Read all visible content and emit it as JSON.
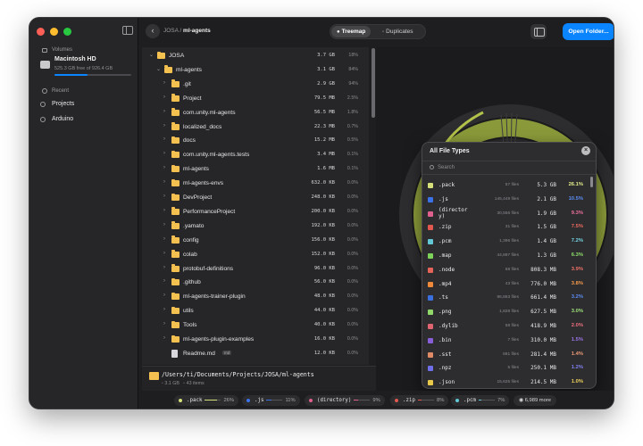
{
  "sidebar": {
    "volumes_label": "Volumes",
    "disk_name": "Macintosh HD",
    "disk_free": "525.3 GB free of 926.4 GB",
    "disk_used_fraction": 0.43,
    "recent_label": "Recent",
    "recent_items": [
      "Projects",
      "Arduino"
    ]
  },
  "toolbar": {
    "breadcrumb_parent": "JOSA",
    "breadcrumb_sep": " / ",
    "breadcrumb_current": "ml-agents",
    "tab_treemap": "Treemap",
    "tab_duplicates": "Duplicates",
    "open_folder": "Open Folder..."
  },
  "tree": [
    {
      "name": "JOSA",
      "size": "3.7 GB",
      "pct": "18%",
      "depth": 0,
      "expanded": true,
      "kind": "folder"
    },
    {
      "name": "ml-agents",
      "size": "3.1 GB",
      "pct": "84%",
      "depth": 1,
      "expanded": true,
      "kind": "folder"
    },
    {
      "name": ".git",
      "size": "2.9 GB",
      "pct": "94%",
      "depth": 2,
      "kind": "folder"
    },
    {
      "name": "Project",
      "size": "79.5 MB",
      "pct": "2.5%",
      "depth": 2,
      "kind": "folder"
    },
    {
      "name": "com.unity.ml-agents",
      "size": "56.5 MB",
      "pct": "1.8%",
      "depth": 2,
      "kind": "folder"
    },
    {
      "name": "localized_docs",
      "size": "22.3 MB",
      "pct": "0.7%",
      "depth": 2,
      "kind": "folder"
    },
    {
      "name": "docs",
      "size": "15.2 MB",
      "pct": "0.5%",
      "depth": 2,
      "kind": "folder"
    },
    {
      "name": "com.unity.ml-agents.tests",
      "size": "3.4 MB",
      "pct": "0.1%",
      "depth": 2,
      "kind": "folder"
    },
    {
      "name": "ml-agents",
      "size": "1.6 MB",
      "pct": "0.1%",
      "depth": 2,
      "kind": "folder"
    },
    {
      "name": "ml-agents-envs",
      "size": "632.0 KB",
      "pct": "0.0%",
      "depth": 2,
      "kind": "folder"
    },
    {
      "name": "DevProject",
      "size": "248.0 KB",
      "pct": "0.0%",
      "depth": 2,
      "kind": "folder"
    },
    {
      "name": "PerformanceProject",
      "size": "200.0 KB",
      "pct": "0.0%",
      "depth": 2,
      "kind": "folder"
    },
    {
      "name": ".yamato",
      "size": "192.0 KB",
      "pct": "0.0%",
      "depth": 2,
      "kind": "folder"
    },
    {
      "name": "config",
      "size": "156.0 KB",
      "pct": "0.0%",
      "depth": 2,
      "kind": "folder"
    },
    {
      "name": "colab",
      "size": "152.0 KB",
      "pct": "0.0%",
      "depth": 2,
      "kind": "folder"
    },
    {
      "name": "protobuf-definitions",
      "size": "96.0 KB",
      "pct": "0.0%",
      "depth": 2,
      "kind": "folder"
    },
    {
      "name": ".github",
      "size": "56.0 KB",
      "pct": "0.0%",
      "depth": 2,
      "kind": "folder"
    },
    {
      "name": "ml-agents-trainer-plugin",
      "size": "48.0 KB",
      "pct": "0.0%",
      "depth": 2,
      "kind": "folder"
    },
    {
      "name": "utils",
      "size": "44.0 KB",
      "pct": "0.0%",
      "depth": 2,
      "kind": "folder"
    },
    {
      "name": "Tools",
      "size": "40.0 KB",
      "pct": "0.0%",
      "depth": 2,
      "kind": "folder"
    },
    {
      "name": "ml-agents-plugin-examples",
      "size": "16.0 KB",
      "pct": "0.0%",
      "depth": 2,
      "kind": "folder"
    },
    {
      "name": "Readme.md",
      "size": "12.0 KB",
      "pct": "0.0%",
      "depth": 2,
      "kind": "file",
      "badge": "md"
    }
  ],
  "pathbar": {
    "path": "/Users/ti/Documents/Projects/JOSA/ml-agents",
    "size": "3.1 GB",
    "items": "43 items"
  },
  "popup": {
    "title": "All File Types",
    "search_placeholder": "Search",
    "rows": [
      {
        "ext": ".pack",
        "count": "57 files",
        "size": "5.3 GB",
        "pct": "26.1%",
        "color": "#d5e07a",
        "pct_color": "#e4ec8a"
      },
      {
        "ext": ".js",
        "count": "145,449 files",
        "size": "2.1 GB",
        "pct": "10.5%",
        "color": "#3c72e8",
        "pct_color": "#5b8cf5"
      },
      {
        "ext": "(director\ny)",
        "count": "30,556 files",
        "size": "1.9 GB",
        "pct": "9.3%",
        "color": "#e0608e",
        "pct_color": "#ef6f9c"
      },
      {
        "ext": ".zip",
        "count": "31 files",
        "size": "1.5 GB",
        "pct": "7.5%",
        "color": "#e0584e",
        "pct_color": "#ef6a5e"
      },
      {
        "ext": ".pcm",
        "count": "1,396 files",
        "size": "1.4 GB",
        "pct": "7.2%",
        "color": "#62c8d6",
        "pct_color": "#74d7e4"
      },
      {
        "ext": ".map",
        "count": "44,897 files",
        "size": "1.3 GB",
        "pct": "6.3%",
        "color": "#7dd35a",
        "pct_color": "#8fe06a"
      },
      {
        "ext": ".node",
        "count": "68 files",
        "size": "808.3 MB",
        "pct": "3.9%",
        "color": "#e5645a",
        "pct_color": "#ef7166"
      },
      {
        "ext": ".mp4",
        "count": "43 files",
        "size": "776.0 MB",
        "pct": "3.8%",
        "color": "#f08a3a",
        "pct_color": "#f59a4a"
      },
      {
        "ext": ".ts",
        "count": "86,863 files",
        "size": "661.4 MB",
        "pct": "3.2%",
        "color": "#3a6fe0",
        "pct_color": "#5b8cf5"
      },
      {
        "ext": ".png",
        "count": "1,828 files",
        "size": "627.5 MB",
        "pct": "3.0%",
        "color": "#90d86a",
        "pct_color": "#9fe47a"
      },
      {
        "ext": ".dylib",
        "count": "58 files",
        "size": "418.9 MB",
        "pct": "2.0%",
        "color": "#e06470",
        "pct_color": "#ef707c"
      },
      {
        "ext": ".bin",
        "count": "7 files",
        "size": "310.0 MB",
        "pct": "1.5%",
        "color": "#8a5ed8",
        "pct_color": "#9b74e6"
      },
      {
        "ext": ".sst",
        "count": "681 files",
        "size": "281.4 MB",
        "pct": "1.4%",
        "color": "#e08a66",
        "pct_color": "#ef9a76"
      },
      {
        "ext": ".npz",
        "count": "5 files",
        "size": "250.1 MB",
        "pct": "1.2%",
        "color": "#6e6ee8",
        "pct_color": "#8080f2"
      },
      {
        "ext": ".json",
        "count": "15,625 files",
        "size": "214.5 MB",
        "pct": "1.0%",
        "color": "#e8c94a",
        "pct_color": "#f0d45a"
      }
    ]
  },
  "legend": {
    "chips": [
      {
        "ext": ".pack",
        "pct": "26%",
        "color": "#d5e07a",
        "fill": 0.26
      },
      {
        "ext": ".js",
        "pct": "11%",
        "color": "#3c72e8",
        "fill": 0.11
      },
      {
        "ext": "(directory)",
        "pct": "9%",
        "color": "#e0608e",
        "fill": 0.09
      },
      {
        "ext": ".zip",
        "pct": "8%",
        "color": "#e0584e",
        "fill": 0.08
      },
      {
        "ext": ".pcm",
        "pct": "7%",
        "color": "#62c8d6",
        "fill": 0.07
      }
    ],
    "more": "6,989 more"
  }
}
